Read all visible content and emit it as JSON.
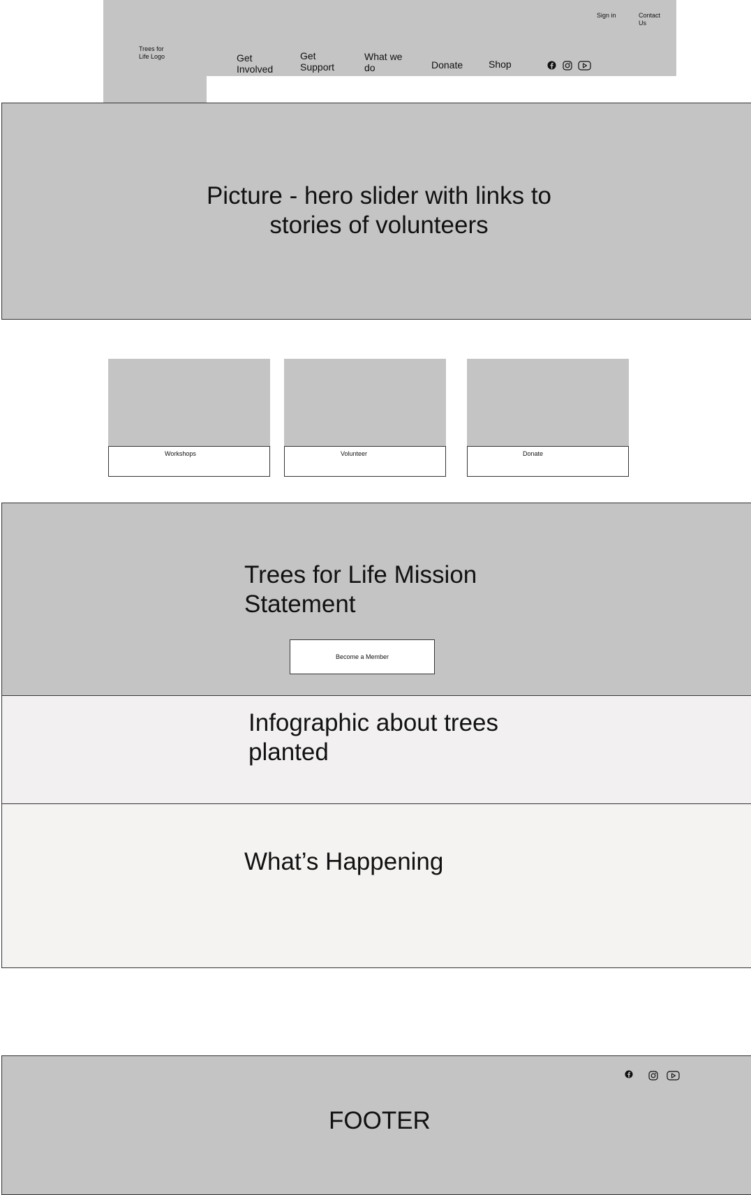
{
  "header": {
    "logo": "Trees for\nLife Logo",
    "utility": {
      "sign_in": "Sign in",
      "contact": "Contact\nUs"
    },
    "nav": [
      {
        "label": "Get\nInvolved"
      },
      {
        "label": "Get\nSupport"
      },
      {
        "label": "What we\ndo"
      },
      {
        "label": "Donate"
      },
      {
        "label": "Shop"
      }
    ],
    "social": [
      "facebook-icon",
      "instagram-icon",
      "youtube-icon"
    ]
  },
  "hero": {
    "text": "Picture - hero slider with links to stories of volunteers"
  },
  "cards": [
    {
      "label": "Workshops"
    },
    {
      "label": "Volunteer"
    },
    {
      "label": "Donate"
    }
  ],
  "mission": {
    "title": "Trees for Life Mission\nStatement",
    "button_label": "Become a Member"
  },
  "infographic": {
    "title": "Infographic about trees\nplanted"
  },
  "happening": {
    "title": "What’s Happening"
  },
  "footer": {
    "text": "FOOTER",
    "social": [
      "facebook-icon",
      "instagram-icon",
      "youtube-icon"
    ]
  },
  "colors": {
    "placeholder_gray": "#c4c4c4",
    "infographic_bg": "#f2f0f1",
    "happening_bg": "#f5f3f2",
    "border": "#333333"
  }
}
